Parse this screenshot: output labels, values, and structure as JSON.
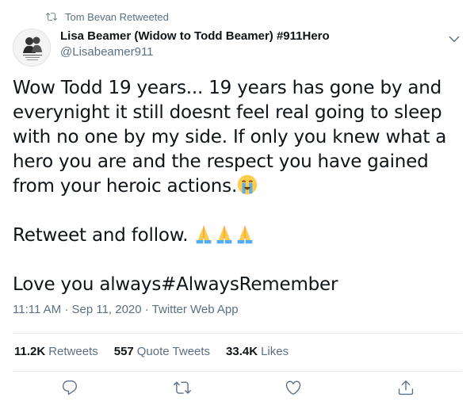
{
  "retweet_banner": {
    "text": "Tom Bevan Retweeted",
    "icon": "retweet-icon"
  },
  "author": {
    "name": "Lisa Beamer (Widow to Todd Beamer) #911Hero",
    "handle": "@Lisabeamer911"
  },
  "tweet": {
    "para1": "Wow Todd 19 years... 19 years has gone by and everynight it still doesnt feel real going to sleep with no one by my side. If only you knew what a hero you are and the respect you have gained from your heroic actions.",
    "para2": "Retweet and follow. ",
    "para3": "Love you always#AlwaysRemember",
    "emoji_cry": "loudly-crying-face-emoji",
    "emoji_pray": "folded-hands-emoji"
  },
  "meta": {
    "timestamp": "11:11 AM · Sep 11, 2020 · Twitter Web App"
  },
  "stats": {
    "retweets_count": "11.2K",
    "retweets_label": "Retweets",
    "quotes_count": "557",
    "quotes_label": "Quote Tweets",
    "likes_count": "33.4K",
    "likes_label": "Likes"
  },
  "colors": {
    "secondary_text": "#5b7083",
    "primary_text": "#0f1419",
    "divider": "#e6ecf0"
  }
}
